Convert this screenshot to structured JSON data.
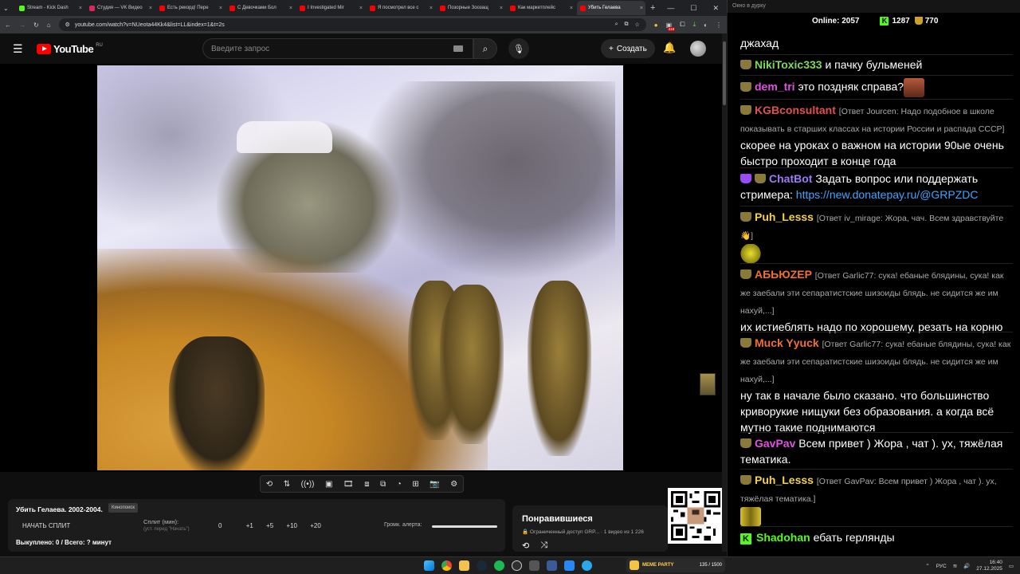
{
  "browser": {
    "tabs": [
      {
        "label": "Stream - Kick Dash",
        "color": "#53fc18"
      },
      {
        "label": "Студия — VK Видео",
        "color": "#e0245e"
      },
      {
        "label": "Есть рекорд! Пере",
        "color": "#ff0000"
      },
      {
        "label": "С Девочками Бол",
        "color": "#ff0000"
      },
      {
        "label": "I Investigated Mir",
        "color": "#ff0000"
      },
      {
        "label": "Я посмотрел все с",
        "color": "#ff0000"
      },
      {
        "label": "Позорные Зоозащ",
        "color": "#ff0000"
      },
      {
        "label": "Как маркетплейс",
        "color": "#ff0000"
      },
      {
        "label": "Убить Гелаева",
        "color": "#ff0000",
        "active": true
      }
    ],
    "url": "youtube.com/watch?v=NUeota44Kk4&list=LL&index=1&t=2s",
    "ext_badge": "418"
  },
  "youtube": {
    "logo_text": "YouTube",
    "region": "RU",
    "search_placeholder": "Введите запрос",
    "create_label": "Создать"
  },
  "split_panel": {
    "title": "Убить Гелаева. 2002-2004.",
    "badge": "Кинопоиск",
    "start_label": "НАЧАТЬ СПЛИТ",
    "split_label": "Сплит (мин):",
    "split_sub": "(уст. перед \"Начать\")",
    "values": [
      "0",
      "+1",
      "+5",
      "+10",
      "+20"
    ],
    "alert_label": "Громк. алерта:",
    "footer": "Выкуплено: 0 / Всего: ? минут"
  },
  "liked": {
    "title": "Понравившиеся",
    "info": "Ограниченный доступ GRP... · 1 видео из 1 226"
  },
  "chat": {
    "header": "Окно в дурку",
    "online_label": "Online:",
    "online": "2057",
    "kick_count": "1287",
    "cup_count": "770",
    "messages": [
      {
        "text": "джахад"
      },
      {
        "user": "NikiToxic333",
        "color": "#7ed957",
        "text": "и пачку бульменей"
      },
      {
        "user": "dem_tri",
        "color": "#e052e0",
        "text": "это поздняк справа?"
      },
      {
        "user": "KGBconsultant",
        "color": "#e05050",
        "reply": "[Ответ Jourcen: Надо подобное в школе показывать в старших классах на истории России и распада СССР]",
        "text": "скорее на уроках о важном на истории 90ые очень быстро проходит в  конце года"
      },
      {
        "user": "ChatBot",
        "color": "#9c7cf4",
        "text": "Задать вопрос или поддержать стримера:",
        "link": "https://new.donatepay.ru/@GRPZDC"
      },
      {
        "user": "Puh_Lesss",
        "color": "#f2d14b",
        "reply": "[Ответ iv_mirage: Жора, чач. Всем здравствуйте 👋]"
      },
      {
        "user": "АБЬЮZЕР",
        "color": "#f07032",
        "reply": "[Ответ Garlic77: сука! ебаные блядины, сука! как же заебали эти сепаратистские шизоиды блядь. не сидится же им нахуй,...]",
        "text": "их истиеблять надо по хорошему, резать на корню"
      },
      {
        "user": "Muck Yyuck",
        "color": "#f07032",
        "reply": "[Ответ Garlic77: сука! ебаные блядины, сука! как же заебали эти сепаратистские шизоиды блядь. не сидится же им нахуй,...]",
        "text": "ну так в начале было сказано. что большинство криворукие нищуки без образования. а когда всё мутно такие поднимаются"
      },
      {
        "user": "GavPav",
        "color": "#e052e0",
        "text": "Всем привет ) Жора , чат ). ух, тяжёлая тематика."
      },
      {
        "user": "Puh_Lesss",
        "color": "#f2d14b",
        "reply": "[Ответ GavPav: Всем привет ) Жора , чат ). ух, тяжёлая тематика.]"
      },
      {
        "user": "Shadohan",
        "color": "#53fc18",
        "text": "ебать герлянды"
      }
    ]
  },
  "taskbar": {
    "meme_title": "MEME PARTY",
    "meme_count": "135 / 1500",
    "lang": "РУС",
    "time": "16:40",
    "date": "27.12.2025"
  }
}
